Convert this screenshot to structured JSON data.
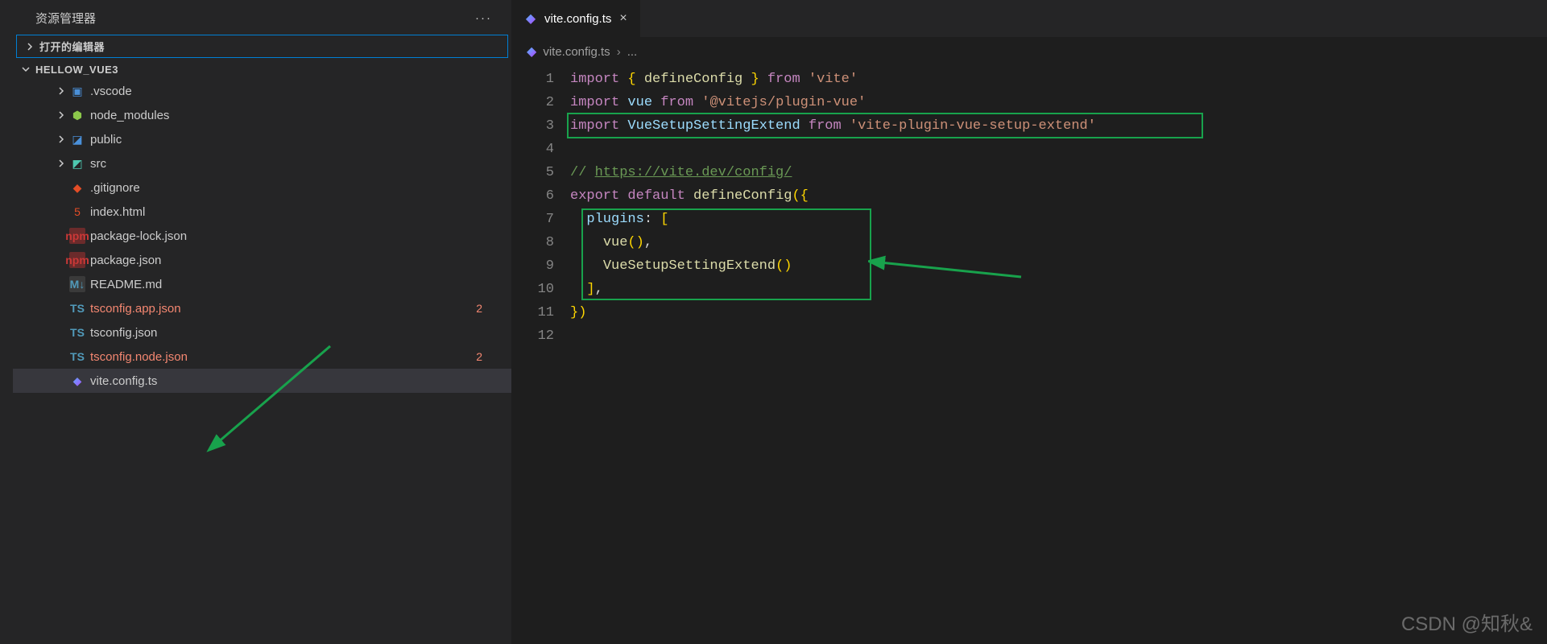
{
  "sidebar": {
    "title": "资源管理器",
    "open_editors_label": "打开的编辑器",
    "project_name": "HELLOW_VUE3",
    "items": [
      {
        "label": ".vscode",
        "icon": "folder-icon",
        "indent": 2,
        "chev": true,
        "error": false,
        "badge": ""
      },
      {
        "label": "node_modules",
        "icon": "node-icon",
        "indent": 2,
        "chev": true,
        "error": false,
        "badge": ""
      },
      {
        "label": "public",
        "icon": "public-icon",
        "indent": 2,
        "chev": true,
        "error": false,
        "badge": ""
      },
      {
        "label": "src",
        "icon": "src-icon",
        "indent": 2,
        "chev": true,
        "error": false,
        "badge": ""
      },
      {
        "label": ".gitignore",
        "icon": "git-icon",
        "indent": 2,
        "chev": false,
        "error": false,
        "badge": ""
      },
      {
        "label": "index.html",
        "icon": "html-icon",
        "indent": 2,
        "chev": false,
        "error": false,
        "badge": ""
      },
      {
        "label": "package-lock.json",
        "icon": "npm-icon",
        "indent": 2,
        "chev": false,
        "error": false,
        "badge": ""
      },
      {
        "label": "package.json",
        "icon": "npm-icon",
        "indent": 2,
        "chev": false,
        "error": false,
        "badge": ""
      },
      {
        "label": "README.md",
        "icon": "md-icon",
        "indent": 2,
        "chev": false,
        "error": false,
        "badge": ""
      },
      {
        "label": "tsconfig.app.json",
        "icon": "ts-icon",
        "indent": 2,
        "chev": false,
        "error": true,
        "badge": "2"
      },
      {
        "label": "tsconfig.json",
        "icon": "ts-icon",
        "indent": 2,
        "chev": false,
        "error": false,
        "badge": ""
      },
      {
        "label": "tsconfig.node.json",
        "icon": "ts-icon",
        "indent": 2,
        "chev": false,
        "error": true,
        "badge": "2"
      },
      {
        "label": "vite.config.ts",
        "icon": "vite-icon",
        "indent": 2,
        "chev": false,
        "error": false,
        "badge": "",
        "selected": true
      }
    ]
  },
  "tabs": {
    "active": {
      "label": "vite.config.ts",
      "icon": "vite-icon"
    }
  },
  "breadcrumb": {
    "file": "vite.config.ts",
    "rest": "..."
  },
  "code": {
    "line_count": 12,
    "tokens": {
      "import": "import",
      "from": "from",
      "export": "export",
      "default": "default",
      "defineConfig": "defineConfig",
      "vite": "'vite'",
      "vue": "vue",
      "vueStr": "'@vitejs/plugin-vue'",
      "VueSetupSettingExtend": "VueSetupSettingExtend",
      "extendStr": "'vite-plugin-vue-setup-extend'",
      "comment": "// ",
      "commentLink": "https://vite.dev/config/",
      "plugins": "plugins",
      "vueCall": "vue",
      "extendCall": "VueSetupSettingExtend"
    }
  },
  "watermark": "CSDN @知秋&",
  "highlights": {
    "box1": {
      "desc": "import VueSetupSettingExtend line"
    },
    "box2": {
      "desc": "plugins array block"
    }
  }
}
